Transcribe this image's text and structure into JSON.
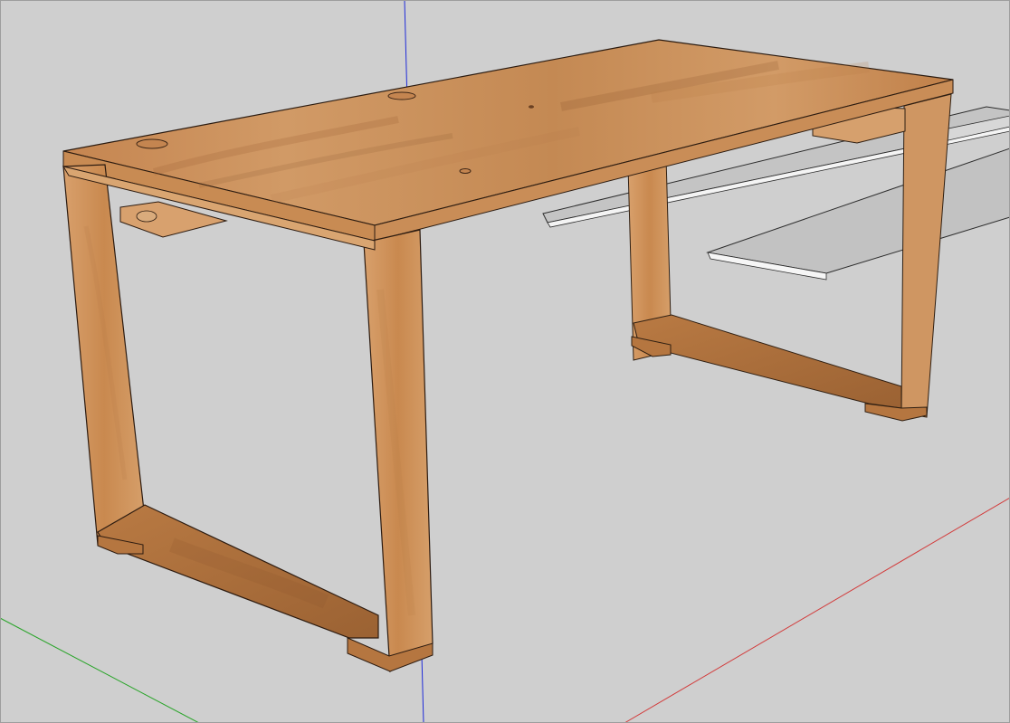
{
  "scene": {
    "background_color": "#cfcfcf",
    "axis_colors": {
      "blue": "#1f2bd9",
      "red": "#d23a3a",
      "green": "#2aa52a"
    },
    "wood_colors": {
      "light": "#d49a67",
      "mid": "#c98b55",
      "dark": "#8f5a2c",
      "edge": "#6f3f1f"
    },
    "panel_colors": {
      "fill": "#c2c2c2",
      "edge": "#ffffff",
      "outline": "#333333"
    }
  }
}
